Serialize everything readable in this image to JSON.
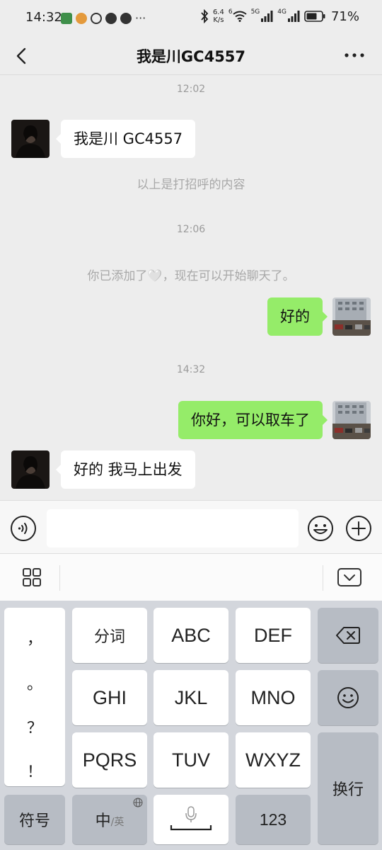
{
  "status_bar": {
    "time": "14:32",
    "net_speed_value": "6.4",
    "net_speed_unit": "K/s",
    "net_5g": "5G",
    "net_4g": "4G",
    "wifi_6": "6",
    "battery": "71%"
  },
  "nav": {
    "title": "我是川GC4557"
  },
  "chat": {
    "messages": [
      {
        "type": "timestamp",
        "text": "12:02"
      },
      {
        "type": "incoming",
        "text": "我是川 GC4557"
      },
      {
        "type": "system",
        "text": "以上是打招呼的内容"
      },
      {
        "type": "timestamp",
        "text": "12:06"
      },
      {
        "type": "system",
        "text": "你已添加了🤍，现在可以开始聊天了。"
      },
      {
        "type": "outgoing",
        "text": "好的"
      },
      {
        "type": "timestamp",
        "text": "14:32"
      },
      {
        "type": "outgoing",
        "text": "你好，可以取车了"
      },
      {
        "type": "incoming",
        "text": "好的 我马上出发"
      }
    ]
  },
  "input": {
    "value": "",
    "placeholder": ""
  },
  "keyboard": {
    "punctuation": [
      "，",
      "。",
      "？",
      "！"
    ],
    "row1": [
      "分词",
      "ABC",
      "DEF"
    ],
    "row2": [
      "GHI",
      "JKL",
      "MNO"
    ],
    "row3": [
      "PQRS",
      "TUV",
      "WXYZ"
    ],
    "symbols": "符号",
    "lang_main": "中",
    "lang_sub": "/英",
    "numbers": "123",
    "enter": "换行"
  },
  "colors": {
    "outgoing_bubble": "#95ec69",
    "incoming_bubble": "#ffffff",
    "chat_background": "#ededed"
  },
  "icons": [
    "back-icon",
    "more-icon",
    "voice-icon",
    "emoji-icon",
    "plus-icon",
    "grid-icon",
    "keyboard-hide-icon",
    "backspace-icon",
    "smiley-icon",
    "mic-icon",
    "globe-icon"
  ]
}
